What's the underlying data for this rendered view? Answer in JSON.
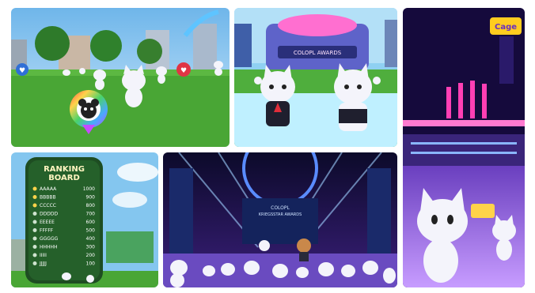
{
  "panels": {
    "p1": {
      "marker_left": "♥",
      "marker_right": "♥"
    },
    "p2": {
      "sign": "COLOPL AWARDS"
    },
    "p3": {
      "sign": "Cage"
    },
    "p4": {
      "title_line1": "RANKING",
      "title_line2": "BOARD",
      "rows": [
        {
          "name": "AAAAA",
          "score": "1000"
        },
        {
          "name": "BBBBB",
          "score": "900"
        },
        {
          "name": "CCCCC",
          "score": "800"
        },
        {
          "name": "DDDDD",
          "score": "700"
        },
        {
          "name": "EEEEE",
          "score": "600"
        },
        {
          "name": "FFFFF",
          "score": "500"
        },
        {
          "name": "GGGGG",
          "score": "400"
        },
        {
          "name": "HHHHH",
          "score": "300"
        },
        {
          "name": "IIIII",
          "score": "200"
        },
        {
          "name": "JJJJJ",
          "score": "100"
        }
      ]
    },
    "p5": {
      "sign_line1": "COLOPL",
      "sign_line2": "KRIEGSSTAR AWARDS"
    }
  },
  "colors": {
    "sky": "#8cc8f0",
    "grass": "#3f9a2e",
    "stage_purple": "#3a1f7a",
    "neon_pink": "#ff3fb4",
    "cat_white": "#f4f4fb"
  }
}
